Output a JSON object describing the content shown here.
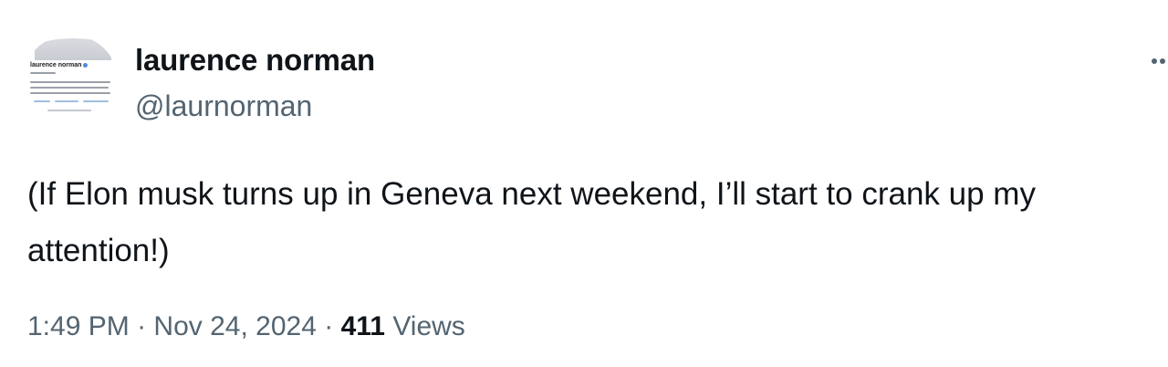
{
  "author": {
    "display_name": "laurence norman",
    "handle": "@laurnorman",
    "avatar_label": "laurence norman"
  },
  "tweet": {
    "text": "(If Elon musk turns up in Geneva next weekend, I’ll start to crank up my attention!)",
    "time": "1:49 PM",
    "separator": "·",
    "date": "Nov 24, 2024",
    "views_count": "411",
    "views_label": "Views"
  },
  "icons": {
    "more": "more-options-icon",
    "verified": "verified-badge-icon"
  },
  "colors": {
    "text_primary": "#0f1419",
    "text_secondary": "#536471",
    "verified_blue": "#4a90d9"
  }
}
